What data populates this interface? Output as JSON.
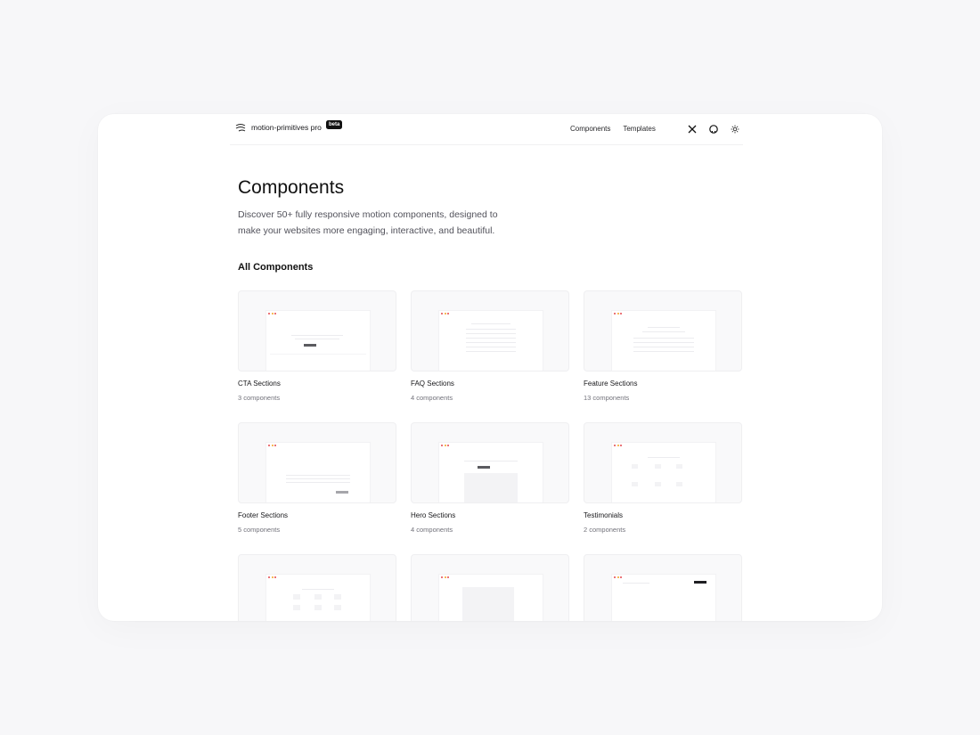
{
  "header": {
    "brand_name": "motion-primitives pro",
    "badge": "beta",
    "nav": [
      {
        "label": "Components"
      },
      {
        "label": "Templates"
      }
    ],
    "icons": [
      "x-logo-icon",
      "github-icon",
      "sun-icon"
    ]
  },
  "main": {
    "title": "Components",
    "description": "Discover 50+ fully responsive motion components, designed to make your websites more engaging, interactive, and beautiful.",
    "section_title": "All Components",
    "cards": [
      {
        "name": "CTA Sections",
        "count": "3 components"
      },
      {
        "name": "FAQ Sections",
        "count": "4 components"
      },
      {
        "name": "Feature Sections",
        "count": "13 components"
      },
      {
        "name": "Footer Sections",
        "count": "5 components"
      },
      {
        "name": "Hero Sections",
        "count": "4 components"
      },
      {
        "name": "Testimonials",
        "count": "2 components"
      },
      {
        "name": "",
        "count": ""
      },
      {
        "name": "",
        "count": ""
      },
      {
        "name": "",
        "count": ""
      }
    ]
  },
  "colors": {
    "page_background": "#f7f7f9",
    "window_background": "#ffffff",
    "text_primary": "#18181b",
    "text_muted": "#71717a",
    "badge_background": "#111111"
  }
}
